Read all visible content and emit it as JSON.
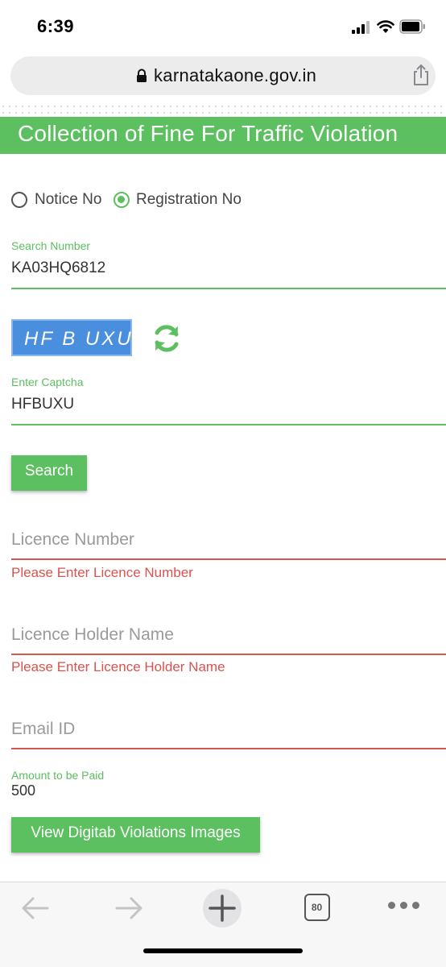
{
  "status_bar": {
    "time": "6:39"
  },
  "browser": {
    "url": "karnatakaone.gov.in",
    "tab_count": "80"
  },
  "page": {
    "title": "Collection of Fine For Traffic Violation",
    "radio": {
      "option1": "Notice No",
      "option2": "Registration No",
      "selected": "Registration No"
    },
    "search_number": {
      "label": "Search Number",
      "value": "KA03HQ6812"
    },
    "captcha": {
      "image_text": "HF B UXU",
      "label": "Enter Captcha",
      "value": "HFBUXU"
    },
    "search_button": "Search",
    "licence_number": {
      "placeholder": "Licence Number",
      "error": "Please Enter Licence Number"
    },
    "licence_holder": {
      "placeholder": "Licence Holder Name",
      "error": "Please Enter Licence Holder Name"
    },
    "email": {
      "placeholder": "Email ID"
    },
    "amount": {
      "label": "Amount to be Paid",
      "value": "500"
    },
    "view_button": "View Digitab Violations Images"
  },
  "colors": {
    "accent": "#5cbf60",
    "error": "#d9534f",
    "captcha_bg": "#4a8ede"
  },
  "icons": [
    "lock-icon",
    "share-icon",
    "refresh-icon",
    "back-arrow-icon",
    "forward-arrow-icon",
    "plus-icon",
    "more-icon"
  ]
}
